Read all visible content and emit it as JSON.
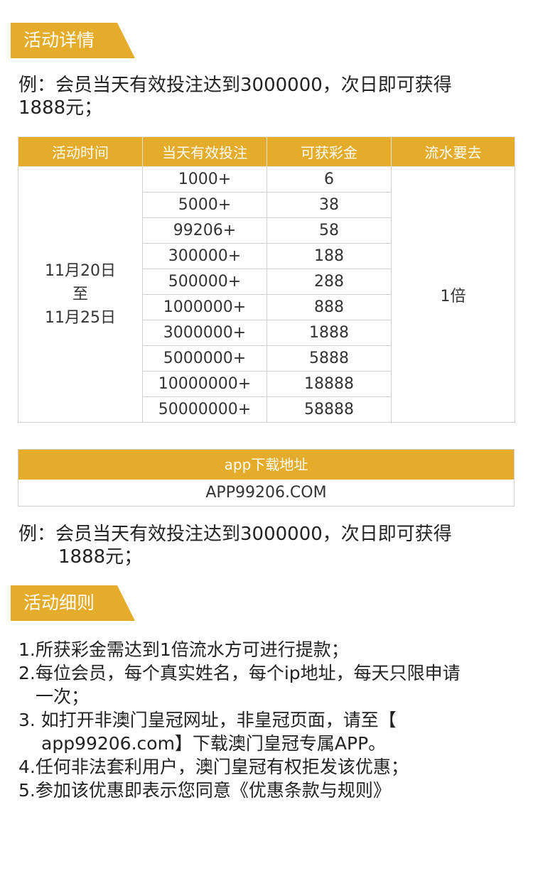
{
  "section1": {
    "title": "活动详情"
  },
  "example1": {
    "line1": "例：会员当天有效投注达到3000000，次日即可获得",
    "line2": "1888元；"
  },
  "table": {
    "headers": [
      "活动时间",
      "当天有效投注",
      "可获彩金",
      "流水要去"
    ],
    "period": [
      "11月20日",
      "至",
      "11月25日"
    ],
    "rows": [
      {
        "bet": "1000+",
        "bonus": "6"
      },
      {
        "bet": "5000+",
        "bonus": "38"
      },
      {
        "bet": "99206+",
        "bonus": "58"
      },
      {
        "bet": "300000+",
        "bonus": "188"
      },
      {
        "bet": "500000+",
        "bonus": "288"
      },
      {
        "bet": "1000000+",
        "bonus": "888"
      },
      {
        "bet": "3000000+",
        "bonus": "1888"
      },
      {
        "bet": "5000000+",
        "bonus": "5888"
      },
      {
        "bet": "10000000+",
        "bonus": "18888"
      },
      {
        "bet": "50000000+",
        "bonus": "58888"
      }
    ],
    "rollover": "1倍"
  },
  "app": {
    "header": "app下载地址",
    "address": "APP99206.COM"
  },
  "example2": {
    "line1": "例：会员当天有效投注达到3000000，次日即可获得",
    "line2": "1888元；"
  },
  "section2": {
    "title": "活动细则"
  },
  "rules": {
    "r1": "1.所获彩金需达到1倍流水方可进行提款；",
    "r2a": "2.每位会员，每个真实姓名，每个ip地址，每天只限申请",
    "r2b": "一次；",
    "r3a": "3. 如打开非澳门皇冠网址，非皇冠页面，请至【",
    "r3b": "app99206.com】下载澳门皇冠专属APP。",
    "r4": "4.任何非法套利用户，澳门皇冠有权拒发该优惠；",
    "r5": "5.参加该优惠即表示您同意《优惠条款与规则》"
  },
  "colors": {
    "accent": "#e5ab2a",
    "border": "#cfcfcf",
    "text": "#222222"
  }
}
